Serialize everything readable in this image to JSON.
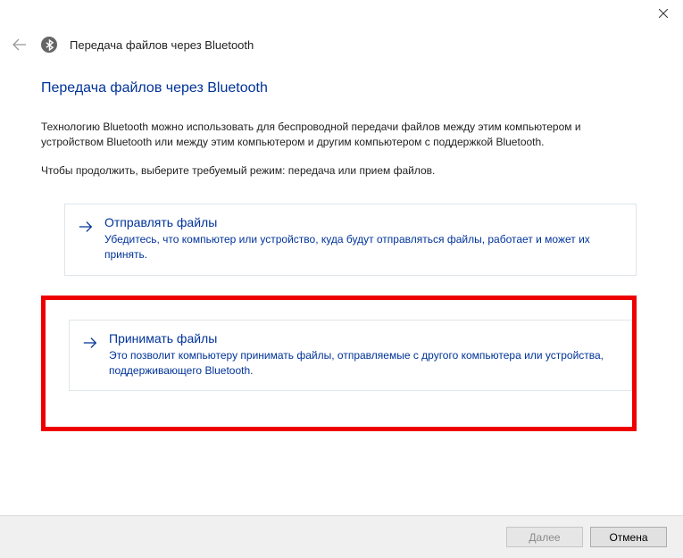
{
  "window": {
    "title": "Передача файлов через Bluetooth"
  },
  "page": {
    "heading": "Передача файлов через Bluetooth",
    "intro1": "Технологию Bluetooth можно использовать для беспроводной передачи файлов между этим компьютером и устройством Bluetooth или между этим компьютером и другим компьютером с поддержкой Bluetooth.",
    "intro2": "Чтобы продолжить, выберите требуемый режим: передача или прием файлов."
  },
  "options": {
    "send": {
      "title": "Отправлять файлы",
      "desc": "Убедитесь, что компьютер или устройство, куда будут отправляться файлы, работает и может их принять."
    },
    "receive": {
      "title": "Принимать файлы",
      "desc": "Это позволит компьютеру принимать файлы, отправляемые с другого компьютера или устройства, поддерживающего Bluetooth."
    }
  },
  "footer": {
    "next": "Далее",
    "cancel": "Отмена"
  }
}
